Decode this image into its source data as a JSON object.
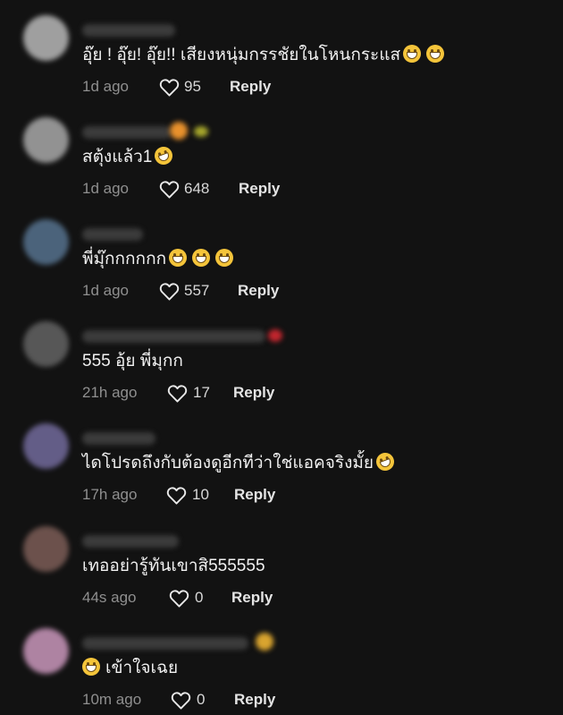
{
  "comments": [
    {
      "text": "อุ๊ย ! อุ๊ย! อุ๊ย!! เสียงหนุ่มกรรชัยในโหนกระแส",
      "emoji": [
        "grin",
        "grin"
      ],
      "time": "1d ago",
      "likes": "95",
      "reply": "Reply",
      "avatar_color": "#c9c9c9"
    },
    {
      "text": "สตุ้งแล้ว1",
      "emoji": [
        "rofl"
      ],
      "time": "1d ago",
      "likes": "648",
      "reply": "Reply",
      "avatar_color": "#bdbdbd"
    },
    {
      "text": "พี่มุ๊กกกกกก",
      "emoji": [
        "grin",
        "grin",
        "grin"
      ],
      "time": "1d ago",
      "likes": "557",
      "reply": "Reply",
      "avatar_color": "#6b8aa8"
    },
    {
      "text": "555 อุ้ย พี่มุกก",
      "emoji": [],
      "time": "21h ago",
      "likes": "17",
      "reply": "Reply",
      "avatar_color": "#7a7a7a"
    },
    {
      "text": "ไดโปรดถึงกับต้องดูอีกทีว่าใช่แอคจริงมั้ย",
      "emoji": [
        "rofl"
      ],
      "time": "17h ago",
      "likes": "10",
      "reply": "Reply",
      "avatar_color": "#8b7fb3"
    },
    {
      "text": "เทออย่ารู้ทันเขาสิ555555",
      "emoji": [],
      "time": "44s ago",
      "likes": "0",
      "reply": "Reply",
      "avatar_color": "#8a6760"
    },
    {
      "text": "เข้าใจเฉย",
      "emoji": [
        "laugh"
      ],
      "time": "10m ago",
      "likes": "0",
      "reply": "Reply",
      "avatar_color": "#e8b6d8"
    }
  ]
}
